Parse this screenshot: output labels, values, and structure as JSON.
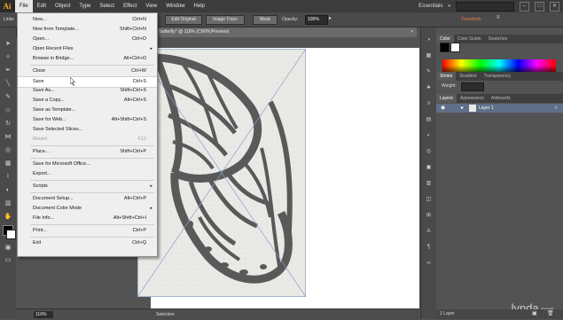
{
  "menubar": {
    "logo": "Ai",
    "items": [
      "File",
      "Edit",
      "Object",
      "Type",
      "Select",
      "Effect",
      "View",
      "Window",
      "Help"
    ],
    "workspace": "Essentials",
    "window_buttons": [
      "–",
      "□",
      "✕"
    ]
  },
  "control": {
    "layer_label": "Linke",
    "edit_original": "Edit Original",
    "image_trace": "Image Trace",
    "mask": "Mask",
    "opacity_label": "Opacity:",
    "opacity_value": "100%",
    "transform": "Transform"
  },
  "document": {
    "tab_title": "butterfly* @ 116% (CMYK/Preview)",
    "close": "×",
    "zoom": "116%",
    "status": "Selection"
  },
  "file_menu": [
    {
      "label": "New...",
      "shortcut": "Ctrl+N"
    },
    {
      "label": "New from Template...",
      "shortcut": "Shift+Ctrl+N"
    },
    {
      "label": "Open...",
      "shortcut": "Ctrl+O"
    },
    {
      "label": "Open Recent Files",
      "shortcut": "",
      "submenu": true
    },
    {
      "label": "Browse in Bridge...",
      "shortcut": "Alt+Ctrl+O"
    },
    {
      "sep": true
    },
    {
      "label": "Close",
      "shortcut": "Ctrl+W"
    },
    {
      "label": "Save",
      "shortcut": "Ctrl+S",
      "highlight": true
    },
    {
      "label": "Save As...",
      "shortcut": "Shift+Ctrl+S"
    },
    {
      "label": "Save a Copy...",
      "shortcut": "Alt+Ctrl+S"
    },
    {
      "label": "Save as Template...",
      "shortcut": ""
    },
    {
      "label": "Save for Web...",
      "shortcut": "Alt+Shift+Ctrl+S"
    },
    {
      "label": "Save Selected Slices...",
      "shortcut": ""
    },
    {
      "label": "Revert",
      "shortcut": "F12",
      "disabled": true
    },
    {
      "sep": true
    },
    {
      "label": "Place...",
      "shortcut": "Shift+Ctrl+P"
    },
    {
      "sep": true
    },
    {
      "label": "Save for Microsoft Office...",
      "shortcut": ""
    },
    {
      "label": "Export...",
      "shortcut": ""
    },
    {
      "sep": true
    },
    {
      "label": "Scripts",
      "shortcut": "",
      "submenu": true
    },
    {
      "sep": true
    },
    {
      "label": "Document Setup...",
      "shortcut": "Alt+Ctrl+P"
    },
    {
      "label": "Document Color Mode",
      "shortcut": "",
      "submenu": true
    },
    {
      "label": "File Info...",
      "shortcut": "Alt+Shift+Ctrl+I"
    },
    {
      "sep": true
    },
    {
      "label": "Print...",
      "shortcut": "Ctrl+P"
    },
    {
      "sep": true
    },
    {
      "label": "Exit",
      "shortcut": "Ctrl+Q"
    }
  ],
  "color_panel": {
    "tabs": [
      "Color",
      "Color Guide",
      "Swatches"
    ]
  },
  "stroke_panel": {
    "tabs": [
      "Stroke",
      "Gradient",
      "Transparency"
    ],
    "weight_label": "Weight:"
  },
  "layers_panel": {
    "tabs": [
      "Layers",
      "Appearance",
      "Artboards"
    ],
    "layer_name": "Layer 1",
    "count": "1 Layer"
  },
  "watermark": {
    "brand": "lynda",
    "suffix": ".com"
  },
  "colors": {
    "accent": "#f7a31c",
    "transform_link": "#f57a4a",
    "layer_highlight": "#5f6f8a"
  }
}
